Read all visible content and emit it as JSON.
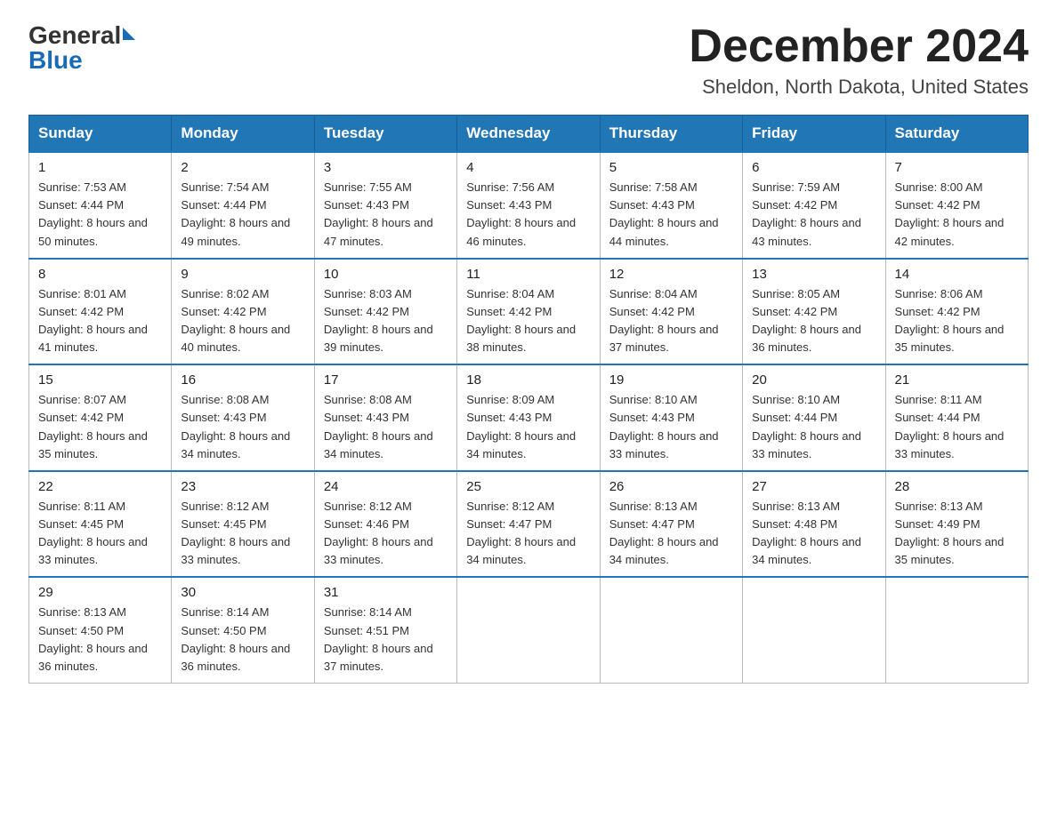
{
  "header": {
    "logo_general": "General",
    "logo_blue": "Blue",
    "month_title": "December 2024",
    "location": "Sheldon, North Dakota, United States"
  },
  "weekdays": [
    "Sunday",
    "Monday",
    "Tuesday",
    "Wednesday",
    "Thursday",
    "Friday",
    "Saturday"
  ],
  "weeks": [
    [
      {
        "day": "1",
        "sunrise": "7:53 AM",
        "sunset": "4:44 PM",
        "daylight": "8 hours and 50 minutes."
      },
      {
        "day": "2",
        "sunrise": "7:54 AM",
        "sunset": "4:44 PM",
        "daylight": "8 hours and 49 minutes."
      },
      {
        "day": "3",
        "sunrise": "7:55 AM",
        "sunset": "4:43 PM",
        "daylight": "8 hours and 47 minutes."
      },
      {
        "day": "4",
        "sunrise": "7:56 AM",
        "sunset": "4:43 PM",
        "daylight": "8 hours and 46 minutes."
      },
      {
        "day": "5",
        "sunrise": "7:58 AM",
        "sunset": "4:43 PM",
        "daylight": "8 hours and 44 minutes."
      },
      {
        "day": "6",
        "sunrise": "7:59 AM",
        "sunset": "4:42 PM",
        "daylight": "8 hours and 43 minutes."
      },
      {
        "day": "7",
        "sunrise": "8:00 AM",
        "sunset": "4:42 PM",
        "daylight": "8 hours and 42 minutes."
      }
    ],
    [
      {
        "day": "8",
        "sunrise": "8:01 AM",
        "sunset": "4:42 PM",
        "daylight": "8 hours and 41 minutes."
      },
      {
        "day": "9",
        "sunrise": "8:02 AM",
        "sunset": "4:42 PM",
        "daylight": "8 hours and 40 minutes."
      },
      {
        "day": "10",
        "sunrise": "8:03 AM",
        "sunset": "4:42 PM",
        "daylight": "8 hours and 39 minutes."
      },
      {
        "day": "11",
        "sunrise": "8:04 AM",
        "sunset": "4:42 PM",
        "daylight": "8 hours and 38 minutes."
      },
      {
        "day": "12",
        "sunrise": "8:04 AM",
        "sunset": "4:42 PM",
        "daylight": "8 hours and 37 minutes."
      },
      {
        "day": "13",
        "sunrise": "8:05 AM",
        "sunset": "4:42 PM",
        "daylight": "8 hours and 36 minutes."
      },
      {
        "day": "14",
        "sunrise": "8:06 AM",
        "sunset": "4:42 PM",
        "daylight": "8 hours and 35 minutes."
      }
    ],
    [
      {
        "day": "15",
        "sunrise": "8:07 AM",
        "sunset": "4:42 PM",
        "daylight": "8 hours and 35 minutes."
      },
      {
        "day": "16",
        "sunrise": "8:08 AM",
        "sunset": "4:43 PM",
        "daylight": "8 hours and 34 minutes."
      },
      {
        "day": "17",
        "sunrise": "8:08 AM",
        "sunset": "4:43 PM",
        "daylight": "8 hours and 34 minutes."
      },
      {
        "day": "18",
        "sunrise": "8:09 AM",
        "sunset": "4:43 PM",
        "daylight": "8 hours and 34 minutes."
      },
      {
        "day": "19",
        "sunrise": "8:10 AM",
        "sunset": "4:43 PM",
        "daylight": "8 hours and 33 minutes."
      },
      {
        "day": "20",
        "sunrise": "8:10 AM",
        "sunset": "4:44 PM",
        "daylight": "8 hours and 33 minutes."
      },
      {
        "day": "21",
        "sunrise": "8:11 AM",
        "sunset": "4:44 PM",
        "daylight": "8 hours and 33 minutes."
      }
    ],
    [
      {
        "day": "22",
        "sunrise": "8:11 AM",
        "sunset": "4:45 PM",
        "daylight": "8 hours and 33 minutes."
      },
      {
        "day": "23",
        "sunrise": "8:12 AM",
        "sunset": "4:45 PM",
        "daylight": "8 hours and 33 minutes."
      },
      {
        "day": "24",
        "sunrise": "8:12 AM",
        "sunset": "4:46 PM",
        "daylight": "8 hours and 33 minutes."
      },
      {
        "day": "25",
        "sunrise": "8:12 AM",
        "sunset": "4:47 PM",
        "daylight": "8 hours and 34 minutes."
      },
      {
        "day": "26",
        "sunrise": "8:13 AM",
        "sunset": "4:47 PM",
        "daylight": "8 hours and 34 minutes."
      },
      {
        "day": "27",
        "sunrise": "8:13 AM",
        "sunset": "4:48 PM",
        "daylight": "8 hours and 34 minutes."
      },
      {
        "day": "28",
        "sunrise": "8:13 AM",
        "sunset": "4:49 PM",
        "daylight": "8 hours and 35 minutes."
      }
    ],
    [
      {
        "day": "29",
        "sunrise": "8:13 AM",
        "sunset": "4:50 PM",
        "daylight": "8 hours and 36 minutes."
      },
      {
        "day": "30",
        "sunrise": "8:14 AM",
        "sunset": "4:50 PM",
        "daylight": "8 hours and 36 minutes."
      },
      {
        "day": "31",
        "sunrise": "8:14 AM",
        "sunset": "4:51 PM",
        "daylight": "8 hours and 37 minutes."
      },
      null,
      null,
      null,
      null
    ]
  ]
}
